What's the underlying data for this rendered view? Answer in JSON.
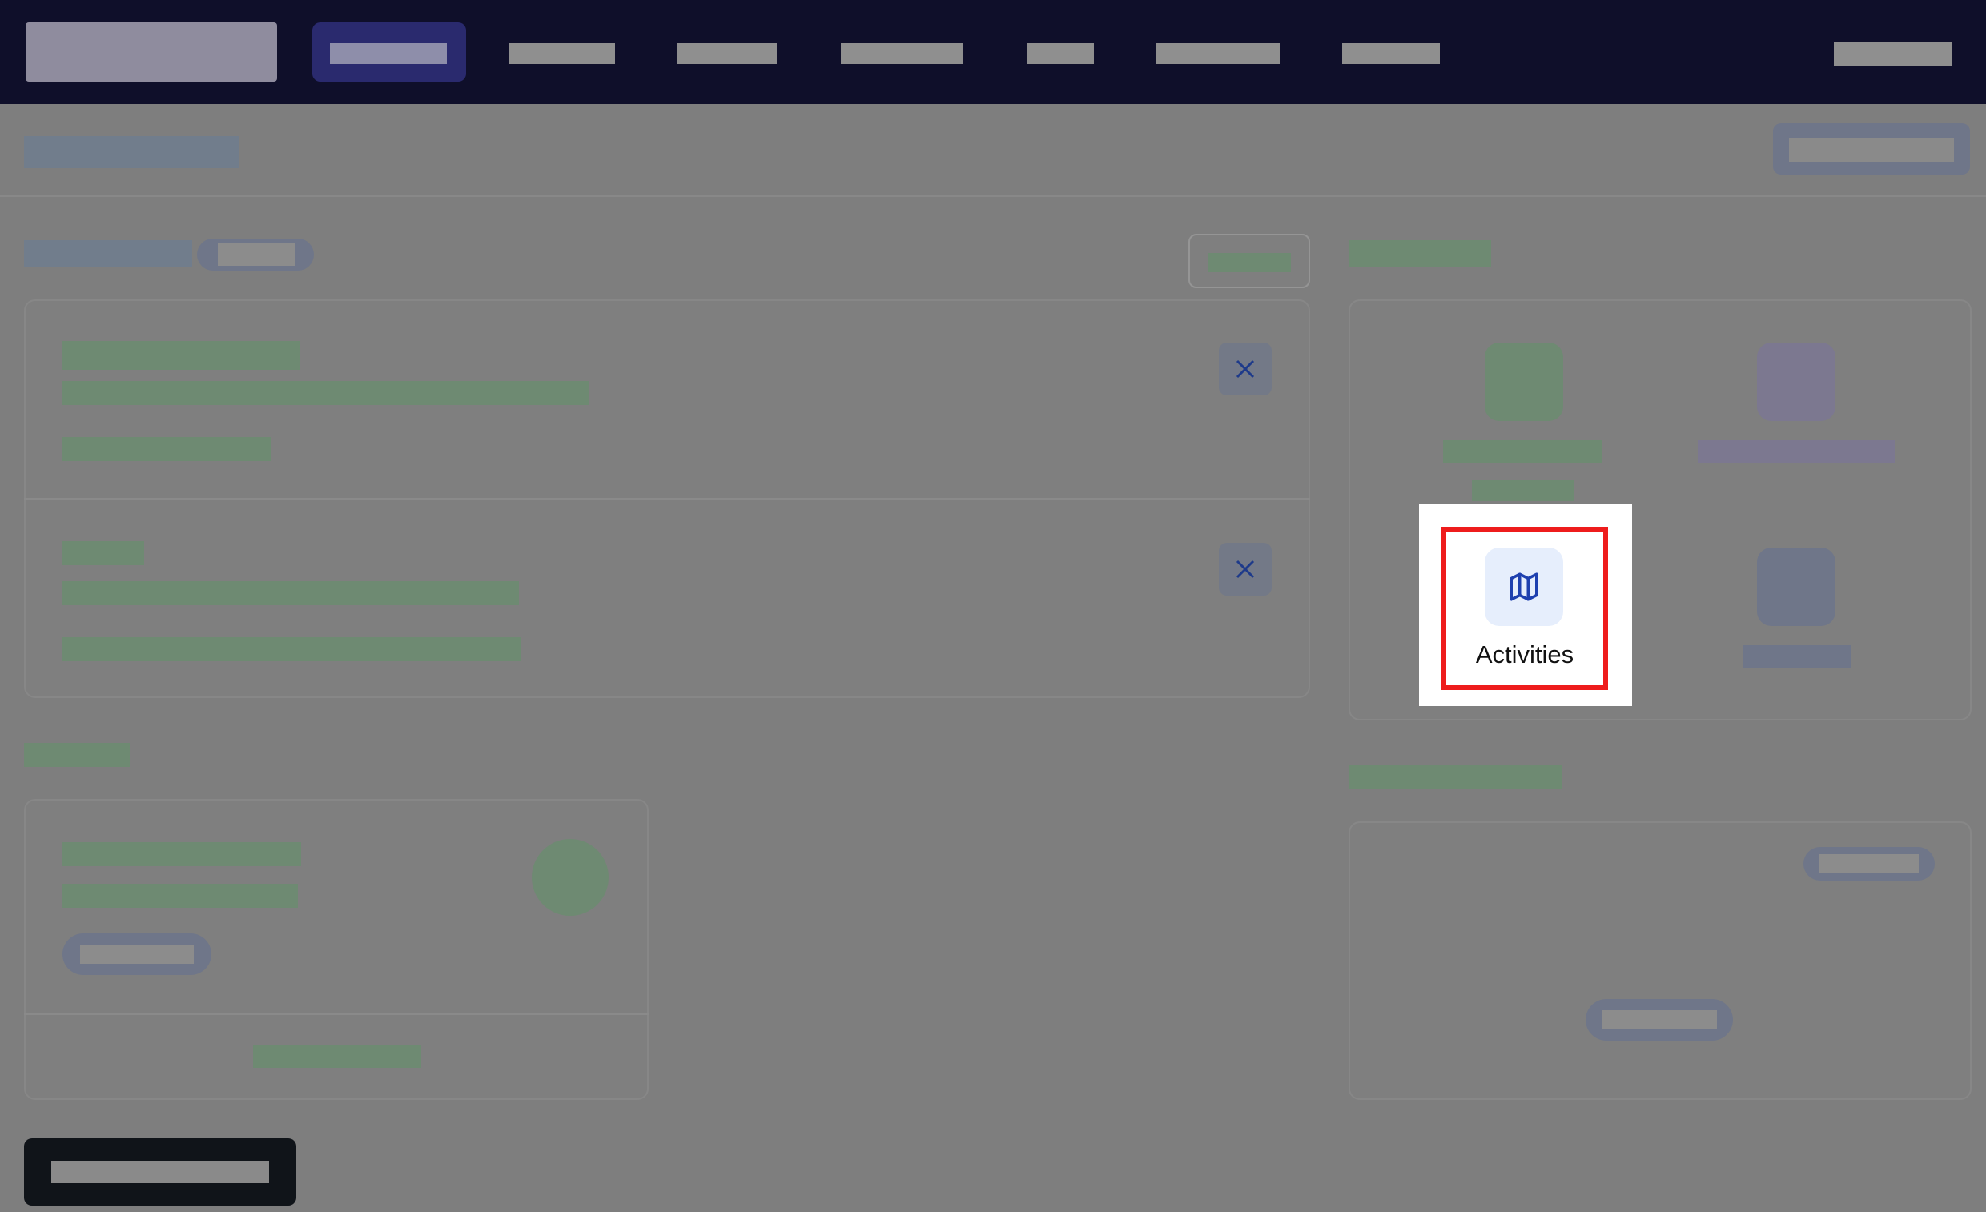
{
  "quick_links": {
    "highlighted": {
      "label": "Activities",
      "icon": "map-icon"
    }
  },
  "colors": {
    "nav_background": "#0f0f2a",
    "highlight_border": "#ee1c1c",
    "icon_accent": "#1e40af",
    "icon_tile_background": "#e6eefc"
  }
}
